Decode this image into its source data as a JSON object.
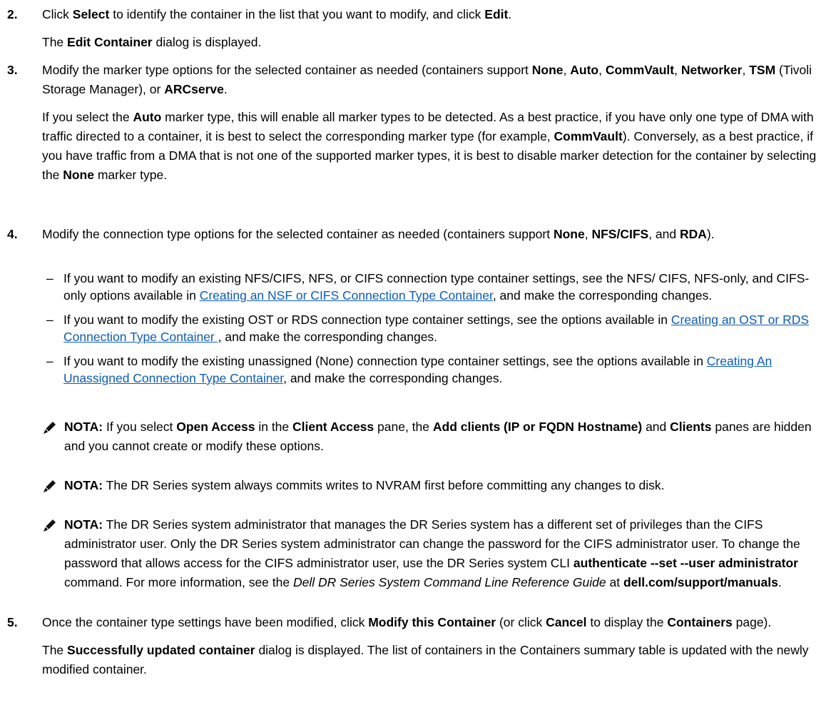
{
  "steps": [
    {
      "num": "2.",
      "line1": [
        "Click ",
        "Select",
        " to identify the container in the list that you want to modify, and click ",
        "Edit",
        "."
      ],
      "line2": [
        "The ",
        "Edit Container",
        " dialog is displayed."
      ]
    },
    {
      "num": "3.",
      "p1": [
        "Modify the marker type options for the selected container as needed (containers support ",
        "None",
        ", ",
        "Auto",
        ", ",
        "CommVault",
        ", ",
        "Networker",
        ", ",
        "TSM",
        " (Tivoli Storage Manager), or ",
        "ARCserve",
        "."
      ],
      "p2": [
        "If you select the ",
        "Auto",
        " marker type, this will enable all marker types to be detected. As a best practice, if you have only one type of DMA with traffic directed to a container, it is best to select the corresponding marker type (for example, ",
        "CommVault",
        "). Conversely, as a best practice, if you have traffic from a DMA that is not one of the supported marker types, it is best to disable marker detection for the container by selecting the ",
        "None",
        " marker type."
      ]
    },
    {
      "num": "4.",
      "p1": [
        "Modify the connection type options for the selected container as needed (containers support ",
        "None",
        ", ",
        "NFS/CIFS",
        ", and ",
        "RDA",
        ")."
      ],
      "bullets": [
        {
          "dash": "–",
          "pre": "If you want to modify an existing NFS/CIFS, NFS, or CIFS connection type container settings, see the NFS/ CIFS, NFS-only, and CIFS-only options available in ",
          "link": "Creating an NSF or CIFS Connection Type Container",
          "post": ", and make the corresponding changes."
        },
        {
          "dash": "–",
          "pre": "If you want to modify the existing OST or RDS connection type container settings, see the options available in ",
          "link": "Creating an OST or RDS Connection Type Container ",
          "post": ", and make the corresponding changes."
        },
        {
          "dash": "–",
          "pre": "If you want to modify the existing unassigned (None) connection type container settings, see the options available in ",
          "link": "Creating An Unassigned Connection Type Container",
          "post": ", and make the corresponding changes."
        }
      ],
      "notes": [
        {
          "label": "NOTA:",
          "parts": [
            " If you select ",
            "Open Access",
            " in the ",
            "Client Access",
            " pane, the ",
            "Add clients (IP or FQDN Hostname)",
            " and ",
            "Clients",
            " panes are hidden and you cannot create or modify these options."
          ]
        },
        {
          "label": "NOTA:",
          "parts": [
            " The DR Series system always commits writes to NVRAM first before committing any changes to disk."
          ]
        },
        {
          "label": "NOTA:",
          "parts": [
            " The DR Series system administrator that manages the DR Series system has a different set of privileges than the CIFS administrator user. Only the DR Series system administrator can change the password for the CIFS administrator user. To change the password that allows access for the CIFS administrator user, use the DR Series system CLI ",
            "authenticate --set --user administrator",
            " command. For more information, see the ",
            "Dell DR Series System Command Line Reference Guide",
            " at ",
            "dell.com/support/manuals",
            "."
          ]
        }
      ]
    },
    {
      "num": "5.",
      "p1": [
        "Once the container type settings have been modified, click ",
        "Modify this Container",
        " (or click ",
        "Cancel",
        " to display the ",
        "Containers",
        " page)."
      ],
      "p2": [
        "The ",
        "Successfully updated container",
        " dialog is displayed. The list of containers in the Containers summary table is updated with the newly modified container."
      ]
    }
  ]
}
